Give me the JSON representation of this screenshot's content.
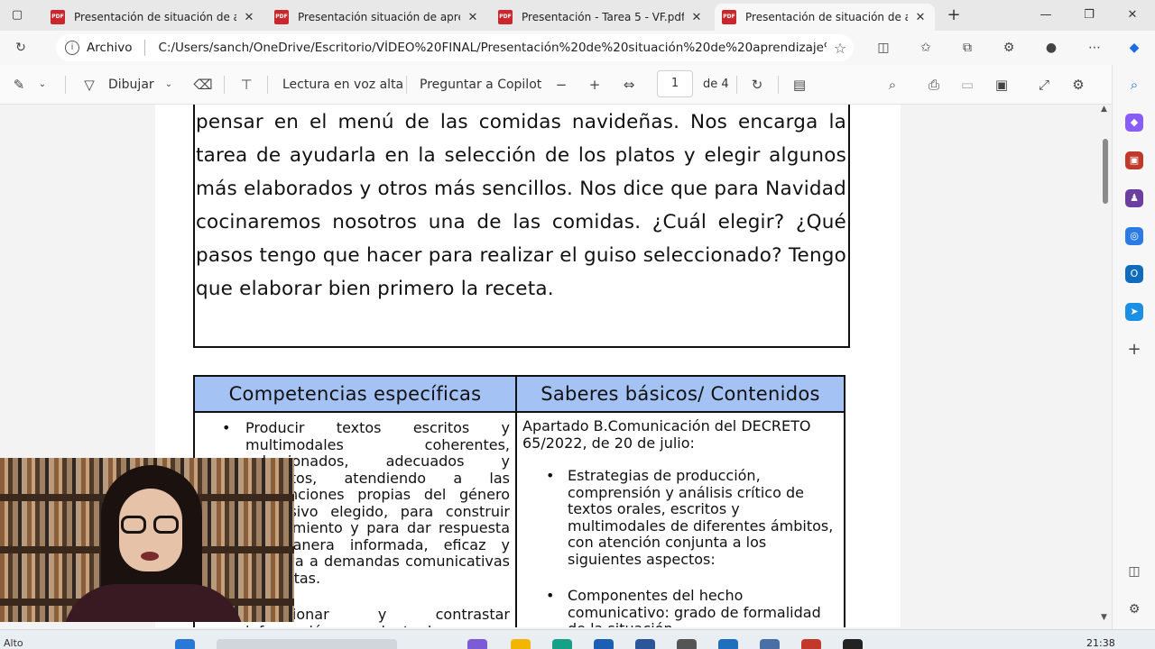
{
  "browser": {
    "tabs": [
      {
        "title": "Presentación de situación de apr",
        "icon": "pdf-icon",
        "active": false
      },
      {
        "title": "Presentación situación de aprend",
        "icon": "pdf-icon",
        "active": false
      },
      {
        "title": "Presentación - Tarea 5 - VF.pdf",
        "icon": "pdf-icon",
        "active": false
      },
      {
        "title": "Presentación de situación de apr",
        "icon": "pdf-icon",
        "active": true
      }
    ],
    "new_tab_icon": "plus-icon",
    "address": {
      "prefix": "Archivo",
      "url": "C:/Users/sanch/OneDrive/Escritorio/VÍDEO%20FINAL/Presentación%20de%20situación%20de%20aprendizaje%2..."
    }
  },
  "pdf_toolbar": {
    "draw_label": "Dibujar",
    "read_aloud_label": "Lectura en voz alta",
    "ask_copilot_label": "Preguntar a Copilot",
    "page_current": "1",
    "page_total": "de 4"
  },
  "document": {
    "scenario_text": "pensar en el menú de las comidas navideñas. Nos encarga la tarea de ayudarla en la selección de los platos y elegir algunos más elaborados y otros más sencillos. Nos dice que para Navidad cocinaremos nosotros una de las comidas. ¿Cuál elegir? ¿Qué pasos tengo que hacer para realizar el guiso seleccionado? Tengo que elaborar bien primero la receta.",
    "table": {
      "header_left": "Competencias específicas",
      "header_right": "Saberes básicos/ Contenidos",
      "left_items": [
        "Producir textos escritos y multimodales coherentes, cohesionados, adecuados y correctos, atendiendo a las convenciones propias del género discursivo elegido, para construir conocimiento y para dar respuesta de manera informada, eficaz y creativa a demandas comunicativas concretas.",
        "Seleccionar y contrastar información procedente de"
      ],
      "right_intro": "Apartado B.Comunicación del DECRETO 65/2022, de 20 de julio:",
      "right_items": [
        "Estrategias de producción, comprensión y análisis crítico de textos orales, escritos y multimodales de diferentes ámbitos, con atención conjunta a los siguientes aspectos:",
        "Componentes del hecho comunicativo: grado de formalidad de la situación"
      ],
      "header_color": "#a4c2f4"
    }
  },
  "status_bar": {
    "left_text": "Alto",
    "clock": "21:38"
  }
}
